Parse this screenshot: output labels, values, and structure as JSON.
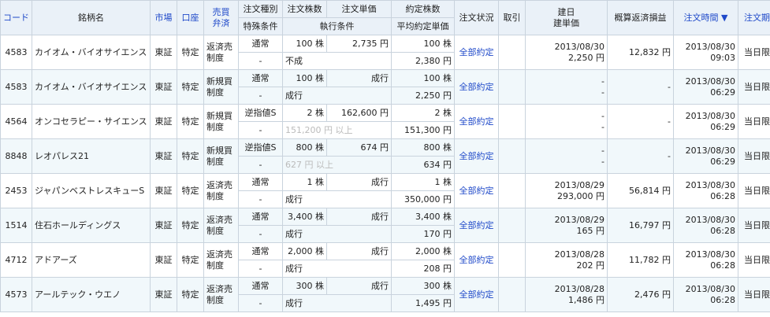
{
  "headers": {
    "code": "コード",
    "name": "銘柄名",
    "market": "市場",
    "account": "口座",
    "trade_line1": "売買",
    "trade_line2": "弁済",
    "order_type": "注文種別",
    "special_cond": "特殊条件",
    "qty": "注文株数",
    "price": "注文単価",
    "exec_cond": "執行条件",
    "filled_qty": "約定株数",
    "avg_price": "平均約定単価",
    "status": "注文状況",
    "cancel": "取引",
    "build_date": "建日",
    "build_price": "建単価",
    "pnl": "概算返済損益",
    "order_time": "注文時間 ▼",
    "expiry": "注文期限"
  },
  "rows": [
    {
      "code": "4583",
      "name": "カイオム・バイオサイエンス",
      "market": "東証",
      "account": "特定",
      "trade1": "返済売",
      "trade2": "制度",
      "otype": "通常",
      "qty": "100 株",
      "price": "2,735 円",
      "special": "-",
      "exec": "不成",
      "filled": "100 株",
      "avg": "2,380 円",
      "status": "全部約定",
      "date1": "2013/08/30",
      "date2": "2,250 円",
      "pnl": "12,832 円",
      "time1": "2013/08/30",
      "time2": "09:03",
      "expiry": "当日限り",
      "exec_gray": false
    },
    {
      "code": "4583",
      "name": "カイオム・バイオサイエンス",
      "market": "東証",
      "account": "特定",
      "trade1": "新規買",
      "trade2": "制度",
      "otype": "通常",
      "qty": "100 株",
      "price": "成行",
      "special": "-",
      "exec": "成行",
      "filled": "100 株",
      "avg": "2,250 円",
      "status": "全部約定",
      "date1": "-",
      "date2": "-",
      "pnl": "-",
      "time1": "2013/08/30",
      "time2": "06:29",
      "expiry": "当日限り",
      "exec_gray": false
    },
    {
      "code": "4564",
      "name": "オンコセラピー・サイエンス",
      "market": "東証",
      "account": "特定",
      "trade1": "新規買",
      "trade2": "制度",
      "otype": "逆指値S",
      "qty": "2 株",
      "price": "162,600 円",
      "special": "-",
      "exec": "151,200 円 以上",
      "filled": "2 株",
      "avg": "151,300 円",
      "status": "全部約定",
      "date1": "-",
      "date2": "-",
      "pnl": "-",
      "time1": "2013/08/30",
      "time2": "06:29",
      "expiry": "当日限り",
      "exec_gray": true
    },
    {
      "code": "8848",
      "name": "レオパレス21",
      "market": "東証",
      "account": "特定",
      "trade1": "新規買",
      "trade2": "制度",
      "otype": "逆指値S",
      "qty": "800 株",
      "price": "674 円",
      "special": "-",
      "exec": "627 円 以上",
      "filled": "800 株",
      "avg": "634 円",
      "status": "全部約定",
      "date1": "-",
      "date2": "-",
      "pnl": "-",
      "time1": "2013/08/30",
      "time2": "06:29",
      "expiry": "当日限り",
      "exec_gray": true
    },
    {
      "code": "2453",
      "name": "ジャパンベストレスキューS",
      "market": "東証",
      "account": "特定",
      "trade1": "返済売",
      "trade2": "制度",
      "otype": "通常",
      "qty": "1 株",
      "price": "成行",
      "special": "-",
      "exec": "成行",
      "filled": "1 株",
      "avg": "350,000 円",
      "status": "全部約定",
      "date1": "2013/08/29",
      "date2": "293,000 円",
      "pnl": "56,814 円",
      "time1": "2013/08/30",
      "time2": "06:28",
      "expiry": "当日限り",
      "exec_gray": false
    },
    {
      "code": "1514",
      "name": "住石ホールディングス",
      "market": "東証",
      "account": "特定",
      "trade1": "返済売",
      "trade2": "制度",
      "otype": "通常",
      "qty": "3,400 株",
      "price": "成行",
      "special": "-",
      "exec": "成行",
      "filled": "3,400 株",
      "avg": "170 円",
      "status": "全部約定",
      "date1": "2013/08/29",
      "date2": "165 円",
      "pnl": "16,797 円",
      "time1": "2013/08/30",
      "time2": "06:28",
      "expiry": "当日限り",
      "exec_gray": false
    },
    {
      "code": "4712",
      "name": "アドアーズ",
      "market": "東証",
      "account": "特定",
      "trade1": "返済売",
      "trade2": "制度",
      "otype": "通常",
      "qty": "2,000 株",
      "price": "成行",
      "special": "-",
      "exec": "成行",
      "filled": "2,000 株",
      "avg": "208 円",
      "status": "全部約定",
      "date1": "2013/08/28",
      "date2": "202 円",
      "pnl": "11,782 円",
      "time1": "2013/08/30",
      "time2": "06:28",
      "expiry": "当日限り",
      "exec_gray": false
    },
    {
      "code": "4573",
      "name": "アールテック・ウエノ",
      "market": "東証",
      "account": "特定",
      "trade1": "返済売",
      "trade2": "制度",
      "otype": "通常",
      "qty": "300 株",
      "price": "成行",
      "special": "-",
      "exec": "成行",
      "filled": "300 株",
      "avg": "1,495 円",
      "status": "全部約定",
      "date1": "2013/08/28",
      "date2": "1,486 円",
      "pnl": "2,476 円",
      "time1": "2013/08/30",
      "time2": "06:28",
      "expiry": "当日限り",
      "exec_gray": false
    }
  ]
}
